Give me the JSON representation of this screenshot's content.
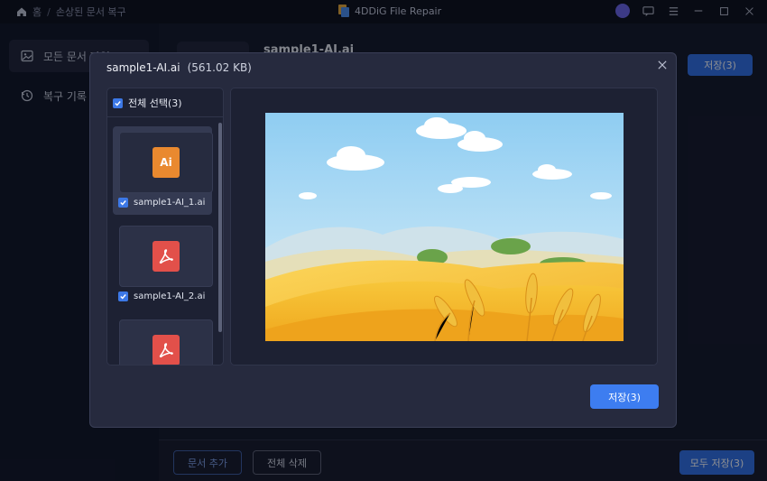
{
  "titlebar": {
    "breadcrumb_home": "홈",
    "breadcrumb_sep": "/",
    "breadcrumb_current": "손상된 문서 복구",
    "app_name": "4DDiG File Repair"
  },
  "sidebar": {
    "items": [
      {
        "label": "모든 문서 파일",
        "icon": "image-icon",
        "active": true
      },
      {
        "label": "복구 기록",
        "icon": "history-icon",
        "active": false
      }
    ]
  },
  "main": {
    "filename": "sample1-AI.ai",
    "save_label": "저장(3)"
  },
  "footer": {
    "add_doc_label": "문서 추가",
    "delete_all_label": "전체 삭제",
    "save_all_label": "모두 저장(3)"
  },
  "modal": {
    "title": "sample1-AI.ai",
    "size": "(561.02 KB)",
    "select_all_label": "전체 선택(3)",
    "files": [
      {
        "name": "sample1-AI_1.ai",
        "type": "ai",
        "icon": "ai-file-icon",
        "checked": true,
        "selected": true
      },
      {
        "name": "sample1-AI_2.ai",
        "type": "pdf",
        "icon": "pdf-file-icon",
        "checked": true,
        "selected": false
      },
      {
        "name": "",
        "type": "pdf",
        "icon": "pdf-file-icon",
        "checked": true,
        "selected": false
      }
    ],
    "ai_badge": "Ai",
    "save_label": "저장(3)"
  },
  "colors": {
    "accent": "#3d7df0",
    "ai_orange": "#e9892f",
    "pdf_red": "#e2504a"
  }
}
